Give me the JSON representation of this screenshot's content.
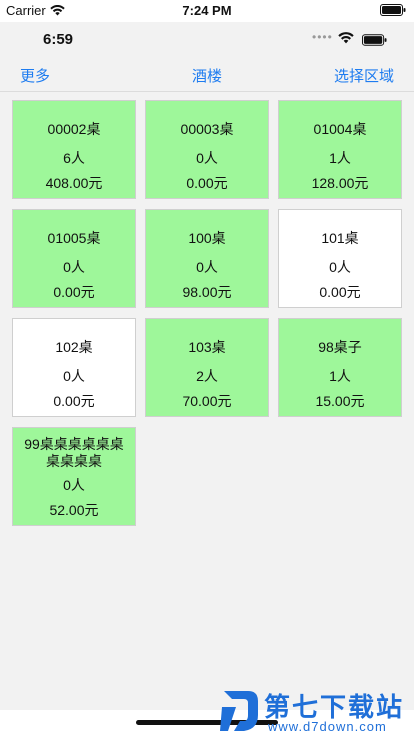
{
  "outer_status": {
    "carrier": "Carrier",
    "time": "7:24 PM"
  },
  "inner_status": {
    "time": "6:59",
    "dots": "••••"
  },
  "navbar": {
    "left": "更多",
    "title": "酒楼",
    "right": "选择区域"
  },
  "tables": [
    {
      "name": "00002桌",
      "people": "6人",
      "amount": "408.00元",
      "state": "busy"
    },
    {
      "name": "00003桌",
      "people": "0人",
      "amount": "0.00元",
      "state": "busy"
    },
    {
      "name": "01004桌",
      "people": "1人",
      "amount": "128.00元",
      "state": "busy"
    },
    {
      "name": "01005桌",
      "people": "0人",
      "amount": "0.00元",
      "state": "busy"
    },
    {
      "name": "100桌",
      "people": "0人",
      "amount": "98.00元",
      "state": "busy"
    },
    {
      "name": "101桌",
      "people": "0人",
      "amount": "0.00元",
      "state": "free"
    },
    {
      "name": "102桌",
      "people": "0人",
      "amount": "0.00元",
      "state": "free"
    },
    {
      "name": "103桌",
      "people": "2人",
      "amount": "70.00元",
      "state": "busy"
    },
    {
      "name": "98桌子",
      "people": "1人",
      "amount": "15.00元",
      "state": "busy"
    },
    {
      "name": "99桌桌桌桌桌桌桌桌桌桌",
      "people": "0人",
      "amount": "52.00元",
      "state": "busy"
    }
  ],
  "colors": {
    "busy": "#9ef79a",
    "free": "#ffffff",
    "accent": "#1e7cf0"
  },
  "watermark": {
    "title": "第七下载站",
    "url": "www.d7down.com"
  }
}
